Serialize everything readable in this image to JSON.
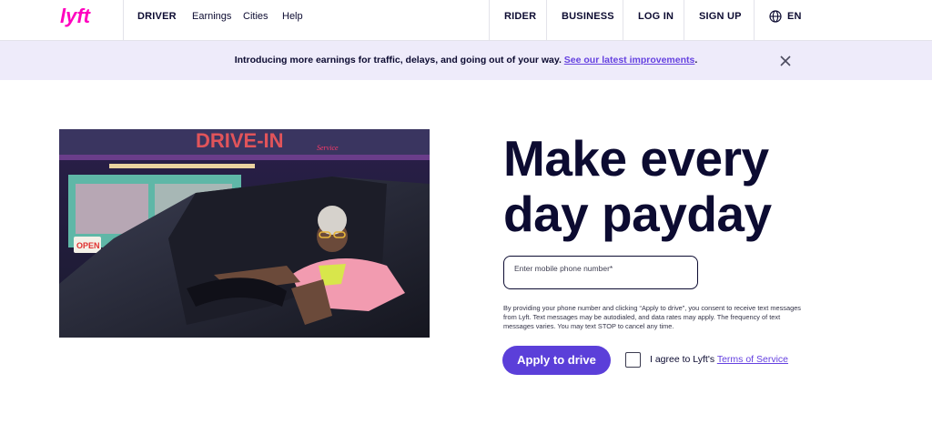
{
  "nav": {
    "logo_text": "lyft",
    "driver": "DRIVER",
    "earnings": "Earnings",
    "cities": "Cities",
    "help": "Help",
    "rider": "RIDER",
    "business": "BUSINESS",
    "login": "LOG IN",
    "signup": "SIGN UP",
    "language": "EN"
  },
  "banner": {
    "text": "Introducing more earnings for traffic, delays, and going out of your way. ",
    "link": "See our latest improvements",
    "suffix": "."
  },
  "hero": {
    "sign_text": "DRIVE-IN",
    "open_sign": "OPEN",
    "service_sign": "Service"
  },
  "main": {
    "headline": "Make every day payday",
    "phone_placeholder": "Enter mobile phone number*",
    "consent": "By providing your phone number and clicking “Apply to drive”, you consent to receive text messages from Lyft. Text messages may be autodialed, and data rates may apply. The frequency of text messages varies. You may text STOP to cancel any time.",
    "apply_button": "Apply to drive",
    "agree_prefix": "I agree to Lyft's ",
    "terms_link": "Terms of Service"
  },
  "colors": {
    "brand_pink": "#ff00bf",
    "accent_purple": "#5b3fd9",
    "navy_text": "#0c0b31",
    "banner_bg": "#eeebfa"
  }
}
